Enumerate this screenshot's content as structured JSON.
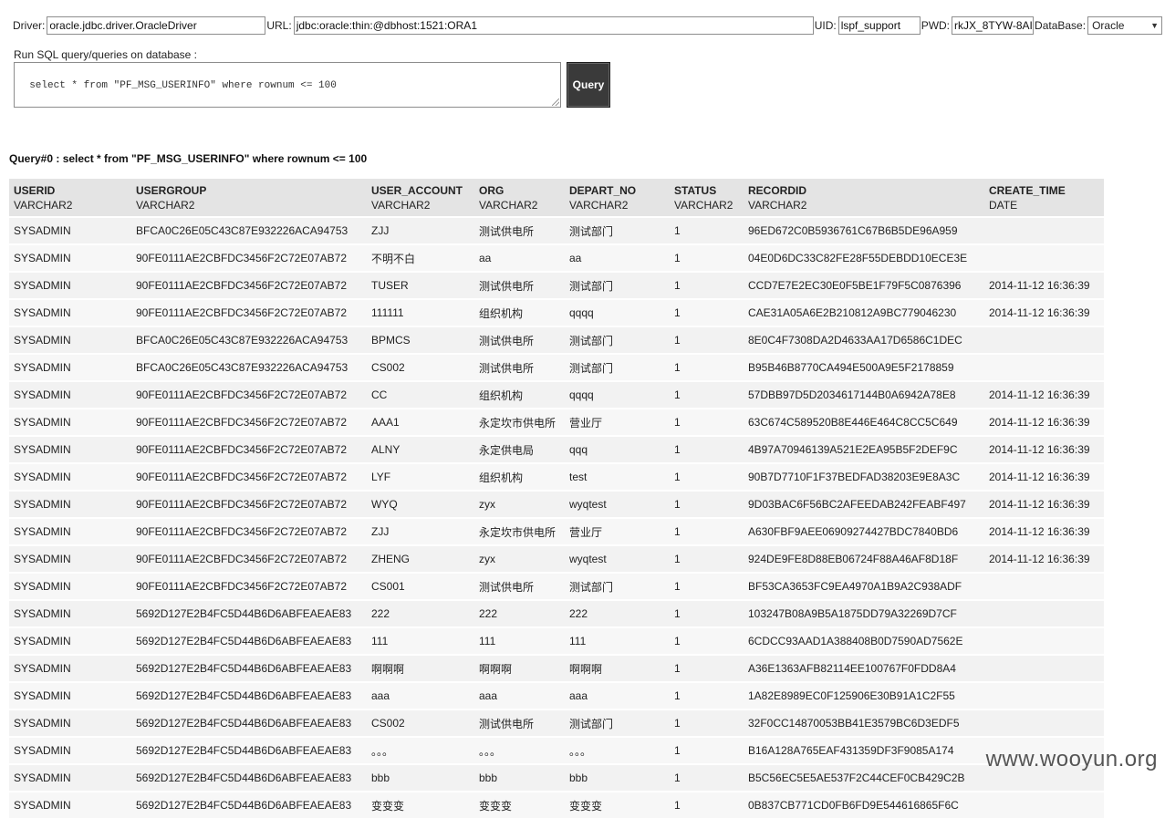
{
  "connection": {
    "driver_label": "Driver:",
    "driver_value": "oracle.jdbc.driver.OracleDriver",
    "url_label": "URL:",
    "url_value": "jdbc:oracle:thin:@dbhost:1521:ORA1",
    "uid_label": "UID:",
    "uid_value": "lspf_support",
    "pwd_label": "PWD:",
    "pwd_value": "rkJX_8TYW-8AI",
    "db_label": "DataBase:",
    "db_selected": "Oracle"
  },
  "sql": {
    "label": "Run SQL query/queries on database :",
    "query": "select * from \"PF_MSG_USERINFO\" where rownum <= 100",
    "button_label": "Query"
  },
  "result": {
    "title": "Query#0 : select * from \"PF_MSG_USERINFO\" where rownum <= 100",
    "columns": [
      {
        "name": "USERID",
        "type": "VARCHAR2"
      },
      {
        "name": "USERGROUP",
        "type": "VARCHAR2"
      },
      {
        "name": "USER_ACCOUNT",
        "type": "VARCHAR2"
      },
      {
        "name": "ORG",
        "type": "VARCHAR2"
      },
      {
        "name": "DEPART_NO",
        "type": "VARCHAR2"
      },
      {
        "name": "STATUS",
        "type": "VARCHAR2"
      },
      {
        "name": "RECORDID",
        "type": "VARCHAR2"
      },
      {
        "name": "CREATE_TIME",
        "type": "DATE"
      }
    ],
    "rows": [
      [
        "SYSADMIN",
        "BFCA0C26E05C43C87E932226ACA94753",
        "ZJJ",
        "测试供电所",
        "测试部门",
        "1",
        "96ED672C0B5936761C67B6B5DE96A959",
        ""
      ],
      [
        "SYSADMIN",
        "90FE0111AE2CBFDC3456F2C72E07AB72",
        "不明不白",
        "aa",
        "aa",
        "1",
        "04E0D6DC33C82FE28F55DEBDD10ECE3E",
        ""
      ],
      [
        "SYSADMIN",
        "90FE0111AE2CBFDC3456F2C72E07AB72",
        "TUSER",
        "测试供电所",
        "测试部门",
        "1",
        "CCD7E7E2EC30E0F5BE1F79F5C0876396",
        "2014-11-12 16:36:39"
      ],
      [
        "SYSADMIN",
        "90FE0111AE2CBFDC3456F2C72E07AB72",
        "111111",
        "组织机构",
        "qqqq",
        "1",
        "CAE31A05A6E2B210812A9BC779046230",
        "2014-11-12 16:36:39"
      ],
      [
        "SYSADMIN",
        "BFCA0C26E05C43C87E932226ACA94753",
        "BPMCS",
        "测试供电所",
        "测试部门",
        "1",
        "8E0C4F7308DA2D4633AA17D6586C1DEC",
        ""
      ],
      [
        "SYSADMIN",
        "BFCA0C26E05C43C87E932226ACA94753",
        "CS002",
        "测试供电所",
        "测试部门",
        "1",
        "B95B46B8770CA494E500A9E5F2178859",
        ""
      ],
      [
        "SYSADMIN",
        "90FE0111AE2CBFDC3456F2C72E07AB72",
        "CC",
        "组织机构",
        "qqqq",
        "1",
        "57DBB97D5D2034617144B0A6942A78E8",
        "2014-11-12 16:36:39"
      ],
      [
        "SYSADMIN",
        "90FE0111AE2CBFDC3456F2C72E07AB72",
        "AAA1",
        "永定坎市供电所",
        "营业厅",
        "1",
        "63C674C589520B8E446E464C8CC5C649",
        "2014-11-12 16:36:39"
      ],
      [
        "SYSADMIN",
        "90FE0111AE2CBFDC3456F2C72E07AB72",
        "ALNY",
        "永定供电局",
        "qqq",
        "1",
        "4B97A70946139A521E2EA95B5F2DEF9C",
        "2014-11-12 16:36:39"
      ],
      [
        "SYSADMIN",
        "90FE0111AE2CBFDC3456F2C72E07AB72",
        "LYF",
        "组织机构",
        "test",
        "1",
        "90B7D7710F1F37BEDFAD38203E9E8A3C",
        "2014-11-12 16:36:39"
      ],
      [
        "SYSADMIN",
        "90FE0111AE2CBFDC3456F2C72E07AB72",
        "WYQ",
        "zyx",
        "wyqtest",
        "1",
        "9D03BAC6F56BC2AFEEDAB242FEABF497",
        "2014-11-12 16:36:39"
      ],
      [
        "SYSADMIN",
        "90FE0111AE2CBFDC3456F2C72E07AB72",
        "ZJJ",
        "永定坎市供电所",
        "营业厅",
        "1",
        "A630FBF9AEE06909274427BDC7840BD6",
        "2014-11-12 16:36:39"
      ],
      [
        "SYSADMIN",
        "90FE0111AE2CBFDC3456F2C72E07AB72",
        "ZHENG",
        "zyx",
        "wyqtest",
        "1",
        "924DE9FE8D88EB06724F88A46AF8D18F",
        "2014-11-12 16:36:39"
      ],
      [
        "SYSADMIN",
        "90FE0111AE2CBFDC3456F2C72E07AB72",
        "CS001",
        "测试供电所",
        "测试部门",
        "1",
        "BF53CA3653FC9EA4970A1B9A2C938ADF",
        ""
      ],
      [
        "SYSADMIN",
        "5692D127E2B4FC5D44B6D6ABFEAEAE83",
        "222",
        "222",
        "222",
        "1",
        "103247B08A9B5A1875DD79A32269D7CF",
        ""
      ],
      [
        "SYSADMIN",
        "5692D127E2B4FC5D44B6D6ABFEAEAE83",
        "111",
        "111",
        "111",
        "1",
        "6CDCC93AAD1A388408B0D7590AD7562E",
        ""
      ],
      [
        "SYSADMIN",
        "5692D127E2B4FC5D44B6D6ABFEAEAE83",
        "啊啊啊",
        "啊啊啊",
        "啊啊啊",
        "1",
        "A36E1363AFB82114EE100767F0FDD8A4",
        ""
      ],
      [
        "SYSADMIN",
        "5692D127E2B4FC5D44B6D6ABFEAEAE83",
        "aaa",
        "aaa",
        "aaa",
        "1",
        "1A82E8989EC0F125906E30B91A1C2F55",
        ""
      ],
      [
        "SYSADMIN",
        "5692D127E2B4FC5D44B6D6ABFEAEAE83",
        "CS002",
        "测试供电所",
        "测试部门",
        "1",
        "32F0CC14870053BB41E3579BC6D3EDF5",
        ""
      ],
      [
        "SYSADMIN",
        "5692D127E2B4FC5D44B6D6ABFEAEAE83",
        "。。。",
        "。。。",
        "。。。",
        "1",
        "B16A128A765EAF431359DF3F9085A174",
        ""
      ],
      [
        "SYSADMIN",
        "5692D127E2B4FC5D44B6D6ABFEAEAE83",
        "bbb",
        "bbb",
        "bbb",
        "1",
        "B5C56EC5E5AE537F2C44CEF0CB429C2B",
        ""
      ],
      [
        "SYSADMIN",
        "5692D127E2B4FC5D44B6D6ABFEAEAE83",
        "变变变",
        "变变变",
        "变变变",
        "1",
        "0B837CB771CD0FB6FD9E544616865F6C",
        ""
      ]
    ]
  },
  "watermark": "www.wooyun.org"
}
